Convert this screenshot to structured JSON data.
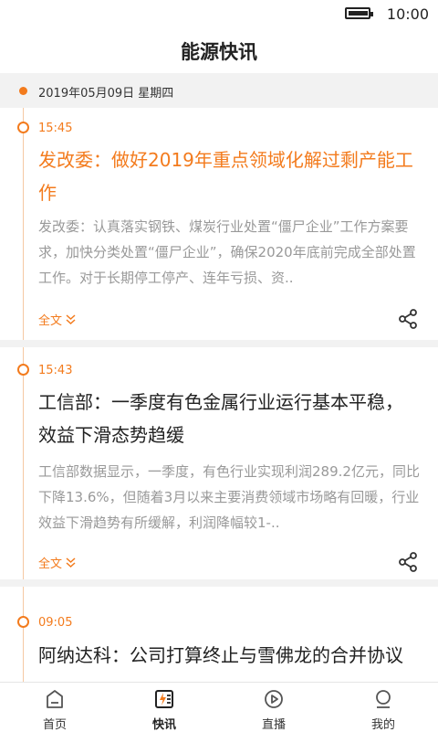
{
  "status": {
    "time": "10:00",
    "battery_level": 0.9
  },
  "header": {
    "title": "能源快讯"
  },
  "date": {
    "text": "2019年05月09日 星期四"
  },
  "news": [
    {
      "time": "15:45",
      "title": "发改委：做好2019年重点领域化解过剩产能工作",
      "summary": "发改委：认真落实钢铁、煤炭行业处置“僵尸企业”工作方案要求，加快分类处置“僵尸企业”，确保2020年底前完成全部处置工作。对于长期停工停产、连年亏损、资..",
      "more_label": "全文",
      "highlighted": true
    },
    {
      "time": "15:43",
      "title": "工信部：一季度有色金属行业运行基本平稳，效益下滑态势趋缓",
      "summary": "工信部数据显示，一季度，有色行业实现利润289.2亿元，同比下降13.6%，但随着3月以来主要消费领域市场略有回暖，行业效益下滑趋势有所缓解，利润降幅较1-..",
      "more_label": "全文",
      "highlighted": false
    },
    {
      "time": "09:05",
      "title": "阿纳达科：公司打算终止与雪佛龙的合并协议",
      "highlighted": false
    }
  ],
  "tabs": [
    {
      "label": "首页",
      "icon": "home-icon",
      "active": false
    },
    {
      "label": "快讯",
      "icon": "flash-news-icon",
      "active": true
    },
    {
      "label": "直播",
      "icon": "play-icon",
      "active": false
    },
    {
      "label": "我的",
      "icon": "profile-icon",
      "active": false
    }
  ],
  "colors": {
    "accent": "#f37b1d",
    "text": "#222222",
    "muted": "#999999",
    "background": "#f2f2f2"
  }
}
